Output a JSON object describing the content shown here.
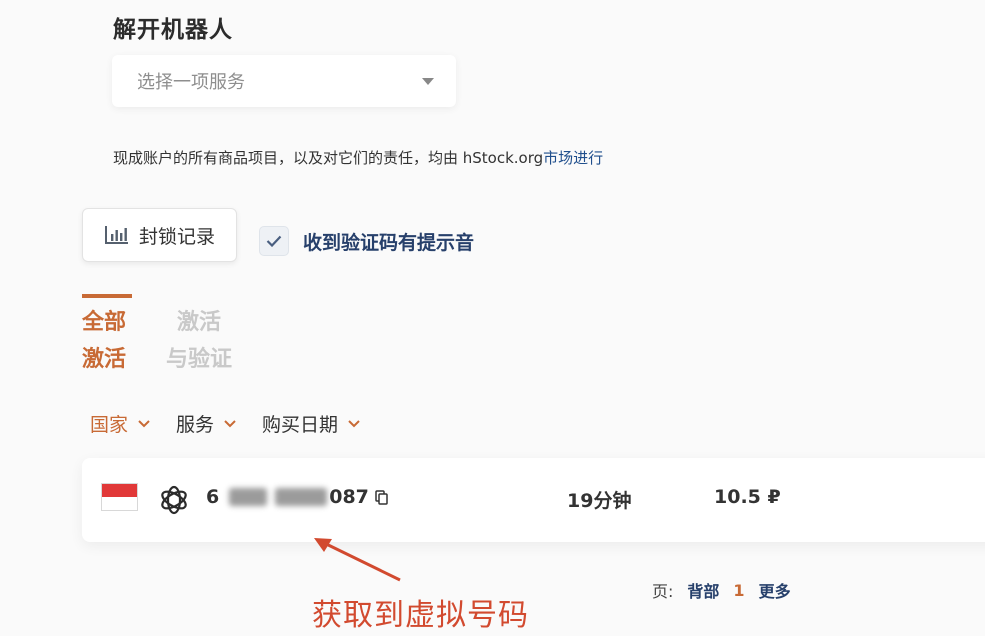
{
  "section": {
    "title": "解开机器人"
  },
  "service_select": {
    "placeholder": "选择一项服务"
  },
  "notice": {
    "text": "现成账户的所有商品项目，以及对它们的责任，均由 hStock.org",
    "link": "市场进行"
  },
  "ban_button": {
    "label": "封锁记录",
    "icon": "bar-chart-icon"
  },
  "sound_option": {
    "label": "收到验证码有提示音",
    "checked": true
  },
  "tabs": [
    {
      "line1": "全部",
      "line2": "激活",
      "active": true
    },
    {
      "line1": "激活",
      "line2": "与验证",
      "active": false
    }
  ],
  "filters": [
    {
      "label": "国家",
      "active": true
    },
    {
      "label": "服务",
      "active": false
    },
    {
      "label": "购买日期",
      "active": false
    }
  ],
  "activation": {
    "flag": "indonesia-flag-icon",
    "service_icon": "openai-icon",
    "phone_prefix": "6",
    "phone_suffix": "087",
    "duration": "19分钟",
    "price": "10.5 ₽"
  },
  "annotation": {
    "text": "获取到虚拟号码"
  },
  "pagination": {
    "label": "页:",
    "back": "背部",
    "current": "1",
    "more": "更多"
  },
  "colors": {
    "accent": "#c86a35",
    "link": "#1f4e8c",
    "annotation": "#d24a2f"
  }
}
